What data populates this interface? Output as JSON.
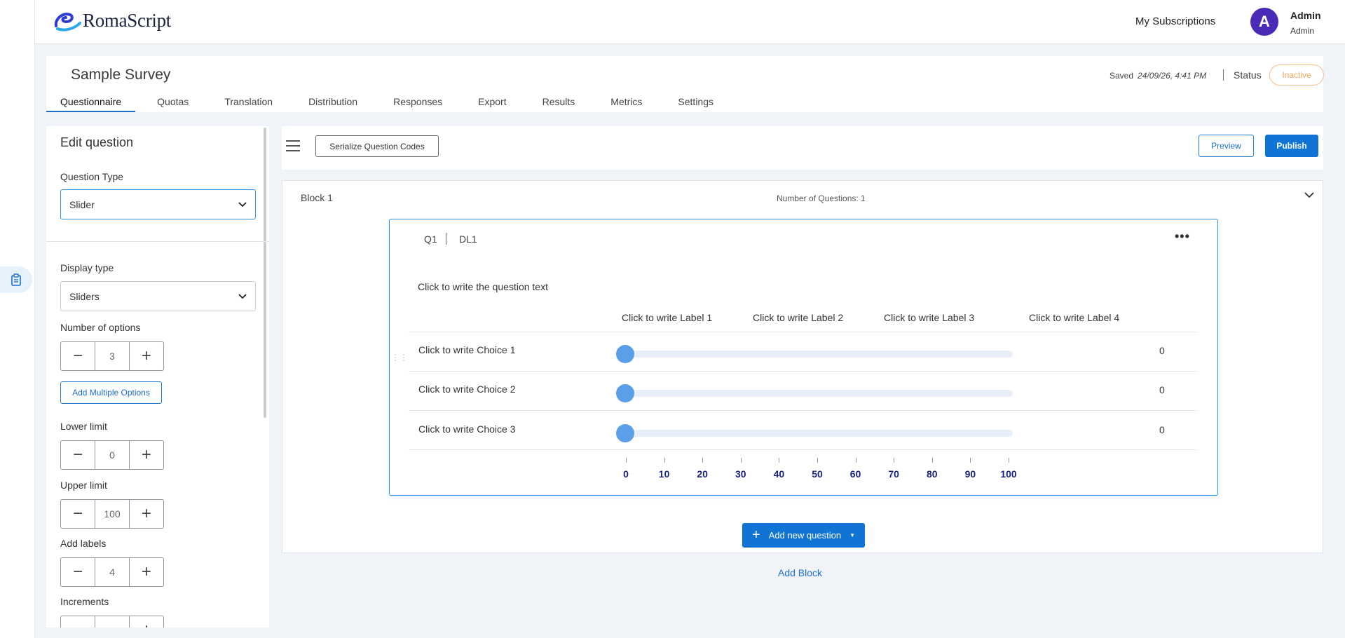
{
  "brand": {
    "name": "RomaScript"
  },
  "header": {
    "subscriptions_label": "My Subscriptions",
    "avatar_initial": "A",
    "user_name": "Admin",
    "user_role": "Admin"
  },
  "survey": {
    "title": "Sample Survey",
    "saved_label": "Saved",
    "saved_time": "24/09/26, 4:41 PM",
    "status_label": "Status",
    "status_value": "Inactive",
    "status_color": "#f0a75e"
  },
  "tabs": [
    {
      "label": "Questionnaire",
      "active": true
    },
    {
      "label": "Quotas"
    },
    {
      "label": "Translation"
    },
    {
      "label": "Distribution"
    },
    {
      "label": "Responses"
    },
    {
      "label": "Export"
    },
    {
      "label": "Results"
    },
    {
      "label": "Metrics"
    },
    {
      "label": "Settings"
    }
  ],
  "edit_panel": {
    "title": "Edit question",
    "question_type_label": "Question Type",
    "question_type_value": "Slider",
    "display_type_label": "Display type",
    "display_type_value": "Sliders",
    "num_options_label": "Number of options",
    "num_options_value": "3",
    "add_multiple_label": "Add Multiple Options",
    "lower_limit_label": "Lower limit",
    "lower_limit_value": "0",
    "upper_limit_label": "Upper limit",
    "upper_limit_value": "100",
    "add_labels_label": "Add labels",
    "add_labels_value": "4",
    "increments_label": "Increments"
  },
  "toolbar": {
    "serialize_label": "Serialize Question Codes",
    "preview_label": "Preview",
    "publish_label": "Publish"
  },
  "block": {
    "title": "Block 1",
    "count_label": "Number of Questions: 1",
    "add_question_label": "Add new question",
    "add_block_label": "Add Block"
  },
  "question": {
    "number": "Q1",
    "code": "DL1",
    "text": "Click to write the question text",
    "labels": [
      "Click to write Label 1",
      "Click to write Label 2",
      "Click to write Label 3",
      "Click to write Label 4"
    ],
    "choices": [
      {
        "label": "Click to write Choice 1",
        "value": "0"
      },
      {
        "label": "Click to write Choice 2",
        "value": "0"
      },
      {
        "label": "Click to write Choice 3",
        "value": "0"
      }
    ],
    "scale": [
      "0",
      "10",
      "20",
      "30",
      "40",
      "50",
      "60",
      "70",
      "80",
      "90",
      "100"
    ],
    "accent_color": "#1a237e",
    "thumb_color": "#5b9fe8"
  }
}
